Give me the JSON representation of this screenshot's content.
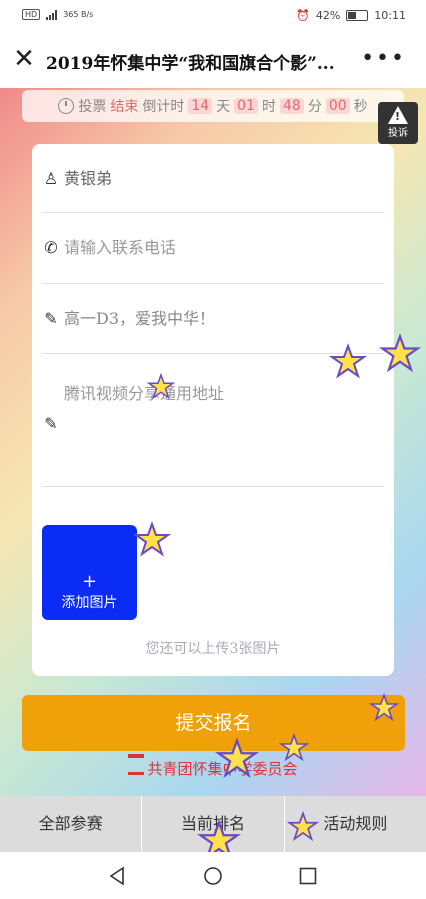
{
  "status_bar": {
    "network": "HD 4G",
    "speed": "365 B/s",
    "battery": "42%",
    "time": "10:11"
  },
  "title_bar": {
    "title": "2019年怀集中学“我和国旗合个影”..."
  },
  "countdown": {
    "prefix": "投票",
    "state": "结束",
    "label": "倒计时",
    "days": "14",
    "days_unit": "天",
    "hours": "01",
    "hours_unit": "时",
    "minutes": "48",
    "minutes_unit": "分",
    "seconds": "00",
    "seconds_unit": "秒"
  },
  "report_button": {
    "label": "投诉"
  },
  "form": {
    "name_value": "黄银弟",
    "phone_placeholder": "请输入联系电话",
    "motto_value": "高一D3，爱我中华！",
    "video_placeholder": "腾讯视频分享通用地址",
    "add_image_label": "添加图片",
    "upload_hint": "您还可以上传3张图片"
  },
  "submit_label": "提交报名",
  "organizer": "共青团怀集中学委员会",
  "tabs": [
    "全部参赛",
    "当前排名",
    "活动规则"
  ],
  "colors": {
    "submit": "#f0a10a",
    "add_image": "#0a2cf5",
    "organizer": "#dd3333",
    "countdown_accent": "#e06a6a"
  }
}
